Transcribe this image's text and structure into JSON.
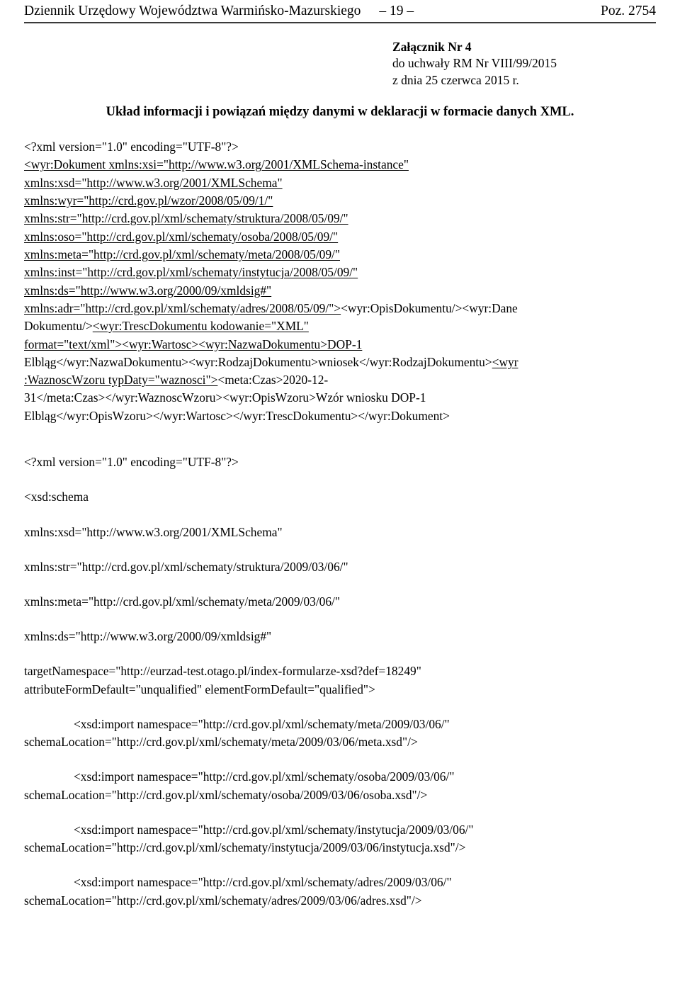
{
  "header": {
    "journal_title": "Dziennik Urzędowy Województwa Warmińsko-Mazurskiego",
    "page_number": "– 19 –",
    "position": "Poz. 2754"
  },
  "annex": {
    "line1": "Załącznik Nr 4",
    "line2": "do uchwały RM Nr VIII/99/2015",
    "line3": "z dnia 25 czerwca 2015 r."
  },
  "title": "Układ informacji i powiązań między danymi w deklaracji w formacie danych XML.",
  "listing1": {
    "lines": [
      {
        "text": "<?xml version=\"1.0\" encoding=\"UTF-8\"?>",
        "underline": "none"
      },
      {
        "text": "<wyr:Dokument xmlns:xsi=\"http://www.w3.org/2001/XMLSchema-instance\"",
        "underline": "full"
      },
      {
        "text": "xmlns:xsd=\"http://www.w3.org/2001/XMLSchema\"",
        "underline": "full"
      },
      {
        "text": "xmlns:wyr=\"http://crd.gov.pl/wzor/2008/05/09/1/\"",
        "underline": "full"
      },
      {
        "text": "xmlns:str=\"http://crd.gov.pl/xml/schematy/struktura/2008/05/09/\"",
        "underline": "full"
      },
      {
        "text": "xmlns:oso=\"http://crd.gov.pl/xml/schematy/osoba/2008/05/09/\"",
        "underline": "full"
      },
      {
        "text": "xmlns:meta=\"http://crd.gov.pl/xml/schematy/meta/2008/05/09/\"",
        "underline": "full"
      },
      {
        "text": "xmlns:inst=\"http://crd.gov.pl/xml/schematy/instytucja/2008/05/09/\"",
        "underline": "full"
      },
      {
        "text": "xmlns:ds=\"http://www.w3.org/2000/09/xmldsig#\"",
        "underline": "full"
      },
      {
        "text": "xmlns:adr=\"http://crd.gov.pl/xml/schematy/adres/2008/05/09/\">",
        "tail": "<wyr:OpisDokumentu/><wyr:Dane",
        "underline": "partial-head"
      },
      {
        "head": "Dokumentu/>",
        "text": "<wyr:TrescDokumentu kodowanie=\"XML\"",
        "underline": "partial-tail"
      },
      {
        "text": "format=\"text/xml\"><wyr:Wartosc><wyr:NazwaDokumentu>DOP-1",
        "underline": "full"
      },
      {
        "head": "Elbląg</wyr:NazwaDokumentu><wyr:RodzajDokumentu>wniosek</wyr:RodzajDokumentu>",
        "text": "<wyr",
        "underline": "partial-tail"
      },
      {
        "text": ":WaznoscWzoru typDaty=\"waznosci\">",
        "tail": "<meta:Czas>2020-12-",
        "underline": "partial-head"
      },
      {
        "text": "31</meta:Czas></wyr:WaznoscWzoru><wyr:OpisWzoru>Wzór wniosku DOP-1",
        "underline": "none"
      },
      {
        "text": "Elbląg</wyr:OpisWzoru></wyr:Wartosc></wyr:TrescDokumentu></wyr:Dokument>",
        "underline": "none"
      }
    ]
  },
  "listing2": {
    "paragraphs": [
      {
        "indent": false,
        "lines": [
          "<?xml version=\"1.0\" encoding=\"UTF-8\"?>"
        ]
      },
      {
        "indent": false,
        "lines": [
          "<xsd:schema"
        ]
      },
      {
        "indent": false,
        "lines": [
          "xmlns:xsd=\"http://www.w3.org/2001/XMLSchema\""
        ]
      },
      {
        "indent": false,
        "lines": [
          "xmlns:str=\"http://crd.gov.pl/xml/schematy/struktura/2009/03/06/\""
        ]
      },
      {
        "indent": false,
        "lines": [
          "xmlns:meta=\"http://crd.gov.pl/xml/schematy/meta/2009/03/06/\""
        ]
      },
      {
        "indent": false,
        "lines": [
          "xmlns:ds=\"http://www.w3.org/2000/09/xmldsig#\""
        ]
      },
      {
        "indent": false,
        "lines": [
          "targetNamespace=\"http://eurzad-test.otago.pl/index-formularze-xsd?def=18249\"",
          "attributeFormDefault=\"unqualified\" elementFormDefault=\"qualified\">"
        ]
      },
      {
        "indent": true,
        "lines": [
          "<xsd:import namespace=\"http://crd.gov.pl/xml/schematy/meta/2009/03/06/\"",
          "schemaLocation=\"http://crd.gov.pl/xml/schematy/meta/2009/03/06/meta.xsd\"/>"
        ]
      },
      {
        "indent": true,
        "lines": [
          "<xsd:import namespace=\"http://crd.gov.pl/xml/schematy/osoba/2009/03/06/\"",
          "schemaLocation=\"http://crd.gov.pl/xml/schematy/osoba/2009/03/06/osoba.xsd\"/>"
        ]
      },
      {
        "indent": true,
        "lines": [
          "<xsd:import namespace=\"http://crd.gov.pl/xml/schematy/instytucja/2009/03/06/\"",
          "schemaLocation=\"http://crd.gov.pl/xml/schematy/instytucja/2009/03/06/instytucja.xsd\"/>"
        ]
      },
      {
        "indent": true,
        "lines": [
          "<xsd:import namespace=\"http://crd.gov.pl/xml/schematy/adres/2009/03/06/\"",
          "schemaLocation=\"http://crd.gov.pl/xml/schematy/adres/2009/03/06/adres.xsd\"/>"
        ]
      }
    ]
  },
  "colors": {
    "text": "#000000",
    "rule": "#3a3a3a",
    "background": "#ffffff"
  }
}
